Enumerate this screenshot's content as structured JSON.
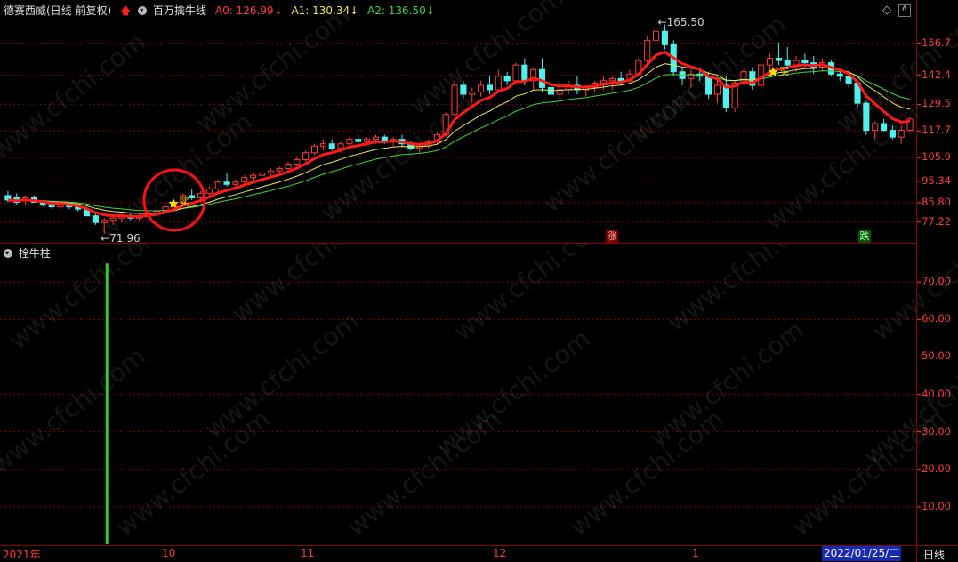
{
  "header": {
    "stock": "德赛西威(日线 前复权)",
    "indicator": "百万擒牛线",
    "a0": "A0: 126.99",
    "a1": "A1: 130.34",
    "a2": "A2: 136.50"
  },
  "sub_panel": {
    "title": "拴牛柱"
  },
  "annotations": {
    "high_label": "165.50",
    "low_label": "71.96",
    "up_badge": "涨",
    "down_badge": "跌",
    "buy_signal": "买"
  },
  "main_yticks": [
    "156.7",
    "142.4",
    "129.5",
    "117.7",
    "105.9",
    "95.34",
    "85.80",
    "77.22"
  ],
  "sub_yticks": [
    "70.00",
    "60.00",
    "50.00",
    "40.00",
    "30.00",
    "20.00",
    "10.00"
  ],
  "xaxis": {
    "labels": [
      "2021年",
      "10",
      "11",
      "12",
      "1"
    ],
    "current_date": "2022/01/25/二",
    "period": "日线"
  },
  "watermark": "www.cfchi.com",
  "colors": {
    "background": "#000000",
    "grid": "#8b0000",
    "up": "#ff3b3b",
    "down": "#4ff0f0",
    "ma_red": "#ff1a1a",
    "ma_yellow": "#e8e850",
    "ma_green": "#3cd63c",
    "bar_green": "#33cc33"
  },
  "chart_data": [
    {
      "type": "candlestick",
      "title": "百万擒牛线",
      "ylim": [
        70,
        168
      ],
      "yticks": [
        156.7,
        142.4,
        129.5,
        117.7,
        105.9,
        95.34,
        85.8,
        77.22
      ],
      "ohlc": [
        [
          89,
          91,
          86,
          87
        ],
        [
          88,
          90,
          85,
          86
        ],
        [
          87,
          89,
          85,
          88
        ],
        [
          88,
          89,
          86,
          86
        ],
        [
          86,
          87,
          84,
          85
        ],
        [
          85,
          86,
          83,
          84
        ],
        [
          84,
          86,
          83,
          85
        ],
        [
          85,
          86,
          83,
          84
        ],
        [
          84,
          85,
          82,
          83
        ],
        [
          83,
          84,
          80,
          80
        ],
        [
          80,
          81,
          76,
          77
        ],
        [
          77,
          79,
          72,
          78
        ],
        [
          78,
          80,
          76,
          79
        ],
        [
          79,
          81,
          77,
          80
        ],
        [
          80,
          81,
          78,
          79
        ],
        [
          79,
          81,
          78,
          80
        ],
        [
          80,
          82,
          79,
          81
        ],
        [
          81,
          83,
          80,
          82
        ],
        [
          82,
          85,
          81,
          84
        ],
        [
          84,
          87,
          83,
          86
        ],
        [
          86,
          90,
          85,
          89
        ],
        [
          89,
          92,
          87,
          88
        ],
        [
          88,
          91,
          86,
          90
        ],
        [
          90,
          93,
          88,
          92
        ],
        [
          92,
          96,
          90,
          95
        ],
        [
          95,
          99,
          93,
          94
        ],
        [
          94,
          96,
          92,
          95
        ],
        [
          95,
          98,
          94,
          97
        ],
        [
          97,
          99,
          95,
          98
        ],
        [
          98,
          100,
          96,
          99
        ],
        [
          99,
          101,
          97,
          100
        ],
        [
          100,
          102,
          98,
          101
        ],
        [
          101,
          104,
          100,
          103
        ],
        [
          103,
          106,
          102,
          105
        ],
        [
          105,
          109,
          104,
          108
        ],
        [
          108,
          112,
          107,
          111
        ],
        [
          111,
          114,
          109,
          112
        ],
        [
          112,
          114,
          109,
          110
        ],
        [
          110,
          113,
          108,
          112
        ],
        [
          112,
          115,
          110,
          114
        ],
        [
          114,
          116,
          112,
          113
        ],
        [
          113,
          115,
          111,
          114
        ],
        [
          114,
          116,
          112,
          115
        ],
        [
          115,
          116,
          112,
          113
        ],
        [
          113,
          115,
          111,
          114
        ],
        [
          114,
          116,
          111,
          112
        ],
        [
          112,
          113,
          109,
          110
        ],
        [
          110,
          112,
          108,
          111
        ],
        [
          111,
          114,
          110,
          113
        ],
        [
          113,
          117,
          112,
          116
        ],
        [
          116,
          126,
          115,
          125
        ],
        [
          125,
          140,
          124,
          138
        ],
        [
          138,
          140,
          132,
          134
        ],
        [
          134,
          137,
          130,
          135
        ],
        [
          135,
          140,
          133,
          138
        ],
        [
          138,
          142,
          134,
          136
        ],
        [
          136,
          145,
          135,
          142
        ],
        [
          142,
          144,
          138,
          140
        ],
        [
          140,
          148,
          139,
          147
        ],
        [
          147,
          150,
          138,
          140
        ],
        [
          140,
          146,
          136,
          145
        ],
        [
          145,
          150,
          135,
          137
        ],
        [
          137,
          140,
          132,
          134
        ],
        [
          134,
          138,
          132,
          136
        ],
        [
          136,
          140,
          134,
          138
        ],
        [
          138,
          142,
          134,
          136
        ],
        [
          136,
          138,
          133,
          137
        ],
        [
          137,
          140,
          135,
          139
        ],
        [
          139,
          142,
          136,
          140
        ],
        [
          140,
          142,
          136,
          141
        ],
        [
          141,
          144,
          138,
          140
        ],
        [
          140,
          145,
          139,
          143
        ],
        [
          143,
          150,
          142,
          149
        ],
        [
          149,
          160,
          148,
          158
        ],
        [
          158,
          165.5,
          156,
          162
        ],
        [
          162,
          165,
          154,
          156
        ],
        [
          156,
          158,
          142,
          144
        ],
        [
          144,
          146,
          138,
          141
        ],
        [
          141,
          145,
          137,
          143
        ],
        [
          143,
          146,
          140,
          142
        ],
        [
          142,
          144,
          132,
          134
        ],
        [
          134,
          140,
          130,
          138
        ],
        [
          138,
          142,
          126,
          128
        ],
        [
          128,
          140,
          126,
          139
        ],
        [
          139,
          145,
          138,
          144
        ],
        [
          144,
          146,
          136,
          138
        ],
        [
          138,
          148,
          137,
          147
        ],
        [
          147,
          152,
          144,
          150
        ],
        [
          150,
          157,
          147,
          149
        ],
        [
          149,
          155,
          145,
          147
        ],
        [
          147,
          151,
          144,
          149
        ],
        [
          149,
          152,
          146,
          148
        ],
        [
          148,
          151,
          143,
          146
        ],
        [
          146,
          150,
          144,
          148
        ],
        [
          148,
          149,
          142,
          143
        ],
        [
          143,
          145,
          140,
          142
        ],
        [
          142,
          144,
          137,
          139
        ],
        [
          139,
          140,
          128,
          130
        ],
        [
          130,
          131,
          116,
          118
        ],
        [
          118,
          122,
          114,
          121
        ],
        [
          121,
          123,
          117,
          118
        ],
        [
          118,
          120,
          114,
          115
        ],
        [
          115,
          120,
          112,
          118
        ],
        [
          118,
          124,
          117,
          123
        ]
      ],
      "markers": {
        "high": 165.5,
        "low": 71.96
      }
    },
    {
      "type": "bar",
      "title": "拴牛柱",
      "ylim": [
        0,
        76
      ],
      "yticks": [
        70,
        60,
        50,
        40,
        30,
        20,
        10
      ],
      "bars": [
        {
          "index": 11,
          "value": 75
        }
      ]
    }
  ]
}
